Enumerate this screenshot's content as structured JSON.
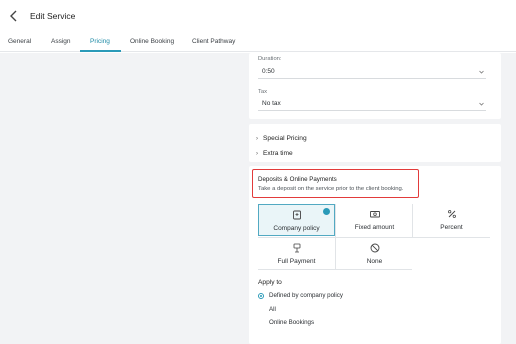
{
  "header": {
    "title": "Edit Service"
  },
  "tabs": [
    {
      "label": "General"
    },
    {
      "label": "Assign"
    },
    {
      "label": "Pricing"
    },
    {
      "label": "Online Booking"
    },
    {
      "label": "Client Pathway"
    }
  ],
  "active_tab": "Pricing",
  "fields": {
    "duration": {
      "label": "Duration:",
      "value": "0:50"
    },
    "tax": {
      "label": "Tax",
      "value": "No tax"
    }
  },
  "expanders": [
    {
      "label": "Special Pricing"
    },
    {
      "label": "Extra time"
    }
  ],
  "deposits": {
    "title": "Deposits & Online Payments",
    "description": "Take a deposit on the service prior to the client booking.",
    "options": [
      {
        "label": "Company policy",
        "icon": "policy-icon"
      },
      {
        "label": "Fixed amount",
        "icon": "cash-icon"
      },
      {
        "label": "Percent",
        "icon": "percent-icon"
      },
      {
        "label": "Full Payment",
        "icon": "person-pay-icon"
      },
      {
        "label": "None",
        "icon": "none-icon"
      }
    ],
    "selected": "Company policy"
  },
  "apply_to": {
    "title": "Apply to",
    "selected_option": "Defined by company policy",
    "items": [
      "All",
      "Online Bookings"
    ]
  },
  "colors": {
    "accent": "#2a9ab8",
    "highlight": "#e23b3b"
  }
}
